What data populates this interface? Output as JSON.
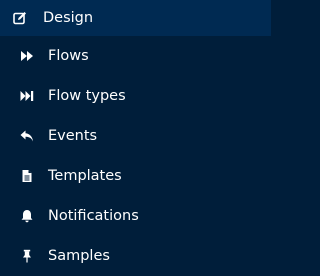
{
  "menu": {
    "items": [
      {
        "label": "Design",
        "icon": "pencil-square-icon",
        "active": true
      },
      {
        "label": "Flows",
        "icon": "fast-forward-icon"
      },
      {
        "label": "Flow types",
        "icon": "step-forward-icon"
      },
      {
        "label": "Events",
        "icon": "reply-icon"
      },
      {
        "label": "Templates",
        "icon": "document-icon"
      },
      {
        "label": "Notifications",
        "icon": "bell-icon"
      },
      {
        "label": "Samples",
        "icon": "pushpin-icon"
      }
    ]
  },
  "colors": {
    "background": "#001e3a",
    "active_background": "#002a52",
    "text": "#ffffff"
  }
}
